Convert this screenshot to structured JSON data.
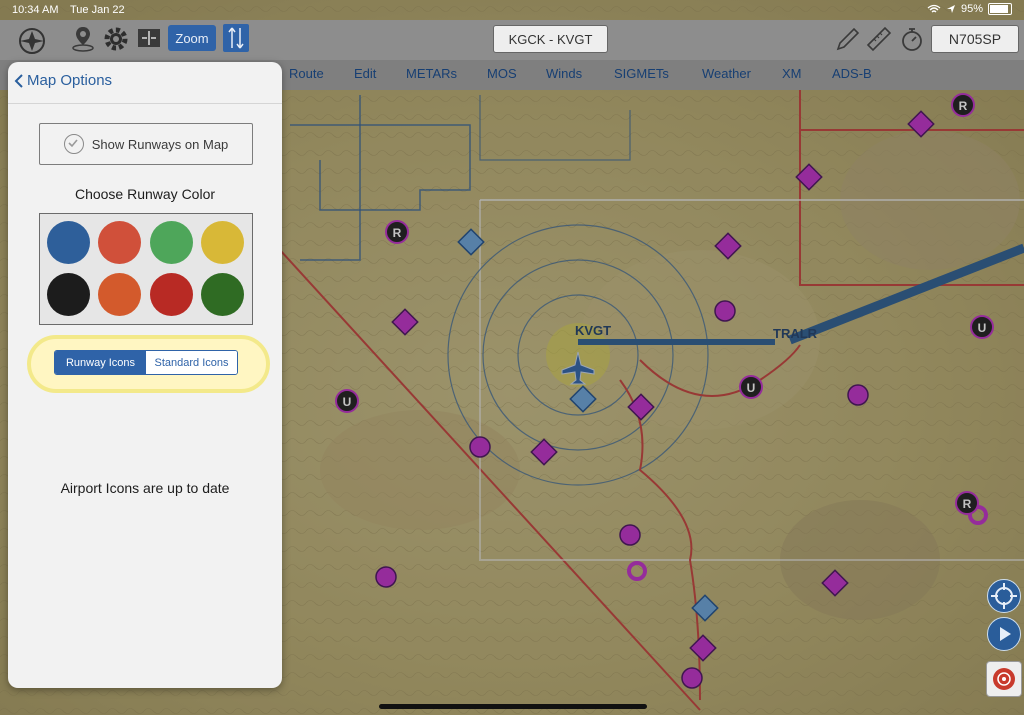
{
  "status_bar": {
    "time": "10:34 AM",
    "date": "Tue Jan 22",
    "battery": "95%"
  },
  "toolbar": {
    "zoom_label": "Zoom",
    "route_label": "KGCK - KVGT",
    "tail_label": "N705SP"
  },
  "menu": {
    "items": [
      "Route",
      "Edit",
      "METARs",
      "MOS",
      "Winds",
      "SIGMETs",
      "Weather",
      "XM",
      "ADS-B"
    ]
  },
  "panel": {
    "back_label": "Map Options",
    "show_runways_label": "Show Runways on Map",
    "choose_color_title": "Choose Runway Color",
    "swatch_colors": [
      "#2e5f9a",
      "#d0503a",
      "#4ea65a",
      "#d8b837",
      "#1c1c1c",
      "#d35a2c",
      "#b82a24",
      "#2f6b23"
    ],
    "segment": {
      "options": [
        "Runway Icons",
        "Standard Icons"
      ],
      "selected": "Runway Icons"
    },
    "status_note": "Airport Icons are up to date"
  },
  "map": {
    "airport_label": "KVGT",
    "waypoint_label": "TRALR",
    "restricted_symbol": "R",
    "unicom_symbol": "U"
  },
  "colors": {
    "accent": "#2f63a8",
    "airport_magenta": "#c02fc8",
    "route_line": "#2c5d91"
  }
}
